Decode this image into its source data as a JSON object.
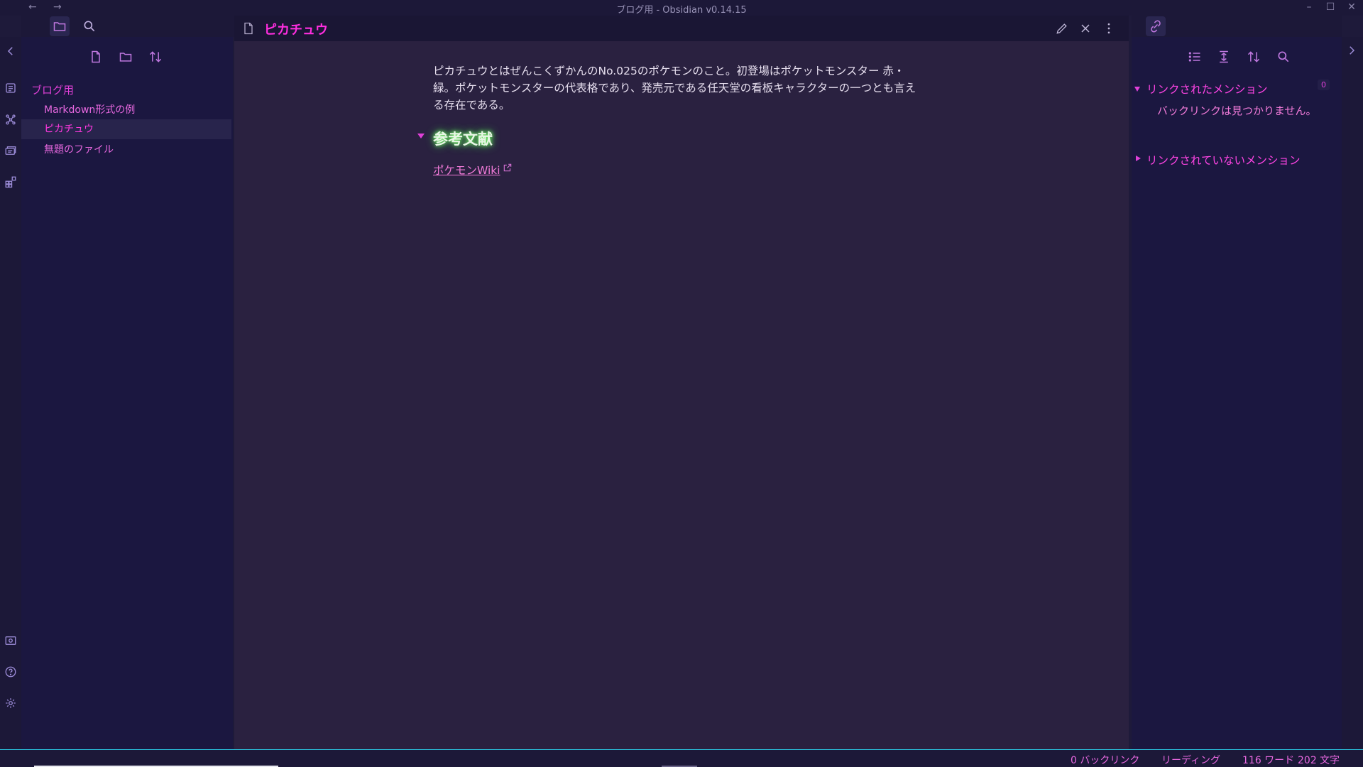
{
  "window": {
    "title": "ブログ用 - Obsidian v0.14.15",
    "back_icon": "←",
    "forward_icon": "→",
    "minimize": "–",
    "maximize": "☐",
    "close": "✕"
  },
  "left_sidebar": {
    "tabs": [
      "folder-icon",
      "search-icon"
    ],
    "toolbar": [
      "new-note-icon",
      "new-folder-icon",
      "sort-icon"
    ],
    "tree": {
      "folder": "ブログ用",
      "files": [
        {
          "label": "Markdown形式の例",
          "active": false
        },
        {
          "label": "ピカチュウ",
          "active": true
        },
        {
          "label": "無題のファイル",
          "active": false
        }
      ]
    }
  },
  "editor": {
    "title": "ピカチュウ",
    "paragraph": "ピカチュウとはぜんこくずかんのNo.025のポケモンのこと。初登場はポケットモンスター 赤・緑。ポケットモンスターの代表格であり、発売元である任天堂の看板キャラクターの一つとも言える存在である。",
    "heading": "参考文献",
    "link_text": "ポケモンWiki"
  },
  "right_sidebar": {
    "linked_mentions": "リンクされたメンション",
    "linked_count": "0",
    "no_backlinks": "バックリンクは見つかりません。",
    "unlinked_mentions": "リンクされていないメンション"
  },
  "status": {
    "backlinks": "0 バックリンク",
    "mode": "リーディング",
    "words": "116 ワード",
    "chars": "202 文字"
  },
  "colors": {
    "accent": "#ff2ee0",
    "link": "#f07ad8",
    "heading_glow": "#7cff70",
    "status_border": "#2ac4e0"
  }
}
